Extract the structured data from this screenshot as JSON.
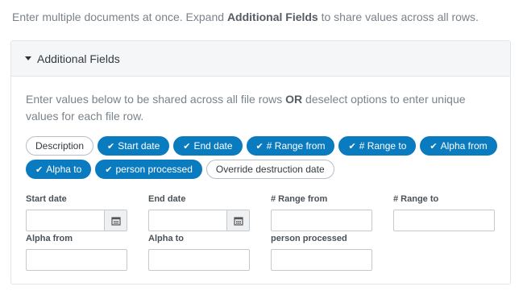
{
  "intro": {
    "prefix": "Enter multiple documents at once. Expand ",
    "bold": "Additional Fields",
    "suffix": " to share values across all rows."
  },
  "panel": {
    "title": "Additional Fields",
    "desc_prefix": "Enter values below to be shared across all file rows ",
    "desc_bold": "OR",
    "desc_suffix": " deselect options to enter unique values for each file row."
  },
  "chips": [
    {
      "label": "Description",
      "selected": false
    },
    {
      "label": "Start date",
      "selected": true
    },
    {
      "label": "End date",
      "selected": true
    },
    {
      "label": "# Range from",
      "selected": true
    },
    {
      "label": "# Range to",
      "selected": true
    },
    {
      "label": "Alpha from",
      "selected": true
    },
    {
      "label": "Alpha to",
      "selected": true
    },
    {
      "label": "person processed",
      "selected": true
    },
    {
      "label": "Override destruction date",
      "selected": false
    }
  ],
  "fields": {
    "start_date": {
      "label": "Start date",
      "value": ""
    },
    "end_date": {
      "label": "End date",
      "value": ""
    },
    "range_from": {
      "label": "# Range from",
      "value": ""
    },
    "range_to": {
      "label": "# Range to",
      "value": ""
    },
    "alpha_from": {
      "label": "Alpha from",
      "value": ""
    },
    "alpha_to": {
      "label": "Alpha to",
      "value": ""
    },
    "person_processed": {
      "label": "person processed",
      "value": ""
    }
  },
  "colors": {
    "chip_selected": "#0a7bbf",
    "chip_unselected_border": "#b8bec4"
  }
}
